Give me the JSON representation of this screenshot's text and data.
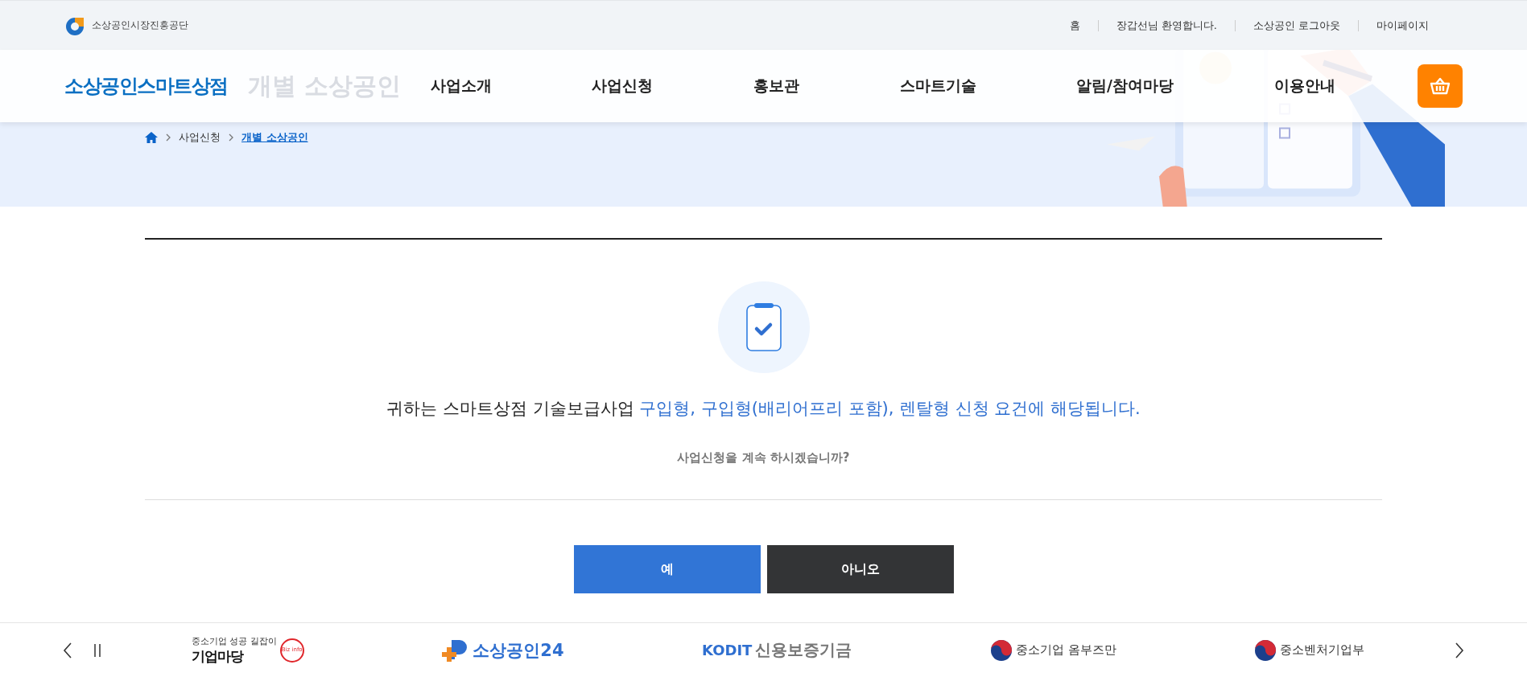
{
  "top_bar": {
    "agency": "소상공인시장진흥공단",
    "links": [
      "홈",
      "장갑선님 환영합니다.",
      "소상공인 로그아웃",
      "마이페이지"
    ]
  },
  "header": {
    "brand": "소상공인스마트상점",
    "menu": [
      {
        "label": "사업소개",
        "selected": false
      },
      {
        "label": "사업신청",
        "selected": false
      },
      {
        "label": "홍보관",
        "selected": false
      },
      {
        "label": "스마트기술",
        "selected": false
      },
      {
        "label": "알림/참여마당",
        "selected": false
      },
      {
        "label": "이용안내",
        "selected": false
      }
    ]
  },
  "hero": {
    "title": "개별 소상공인",
    "breadcrumb": [
      "사업신청",
      "개별 소상공인"
    ]
  },
  "result": {
    "lead": "귀하는 스마트상점 기술보급사업 ",
    "highlight": "구입형, 구입형(배리어프리 포함), 렌탈형 신청 요건에 해당됩니다.",
    "question": "사업신청을 계속 하시겠습니까?"
  },
  "buttons": [
    {
      "label": "예",
      "kind": "primary"
    },
    {
      "label": "아니오",
      "kind": "secondary"
    }
  ],
  "footer": {
    "partners": [
      {
        "kind": "bizinfo",
        "tagline": "중소기업 성공 길잡이",
        "name": "기업마당",
        "badge": "Biz info"
      },
      {
        "kind": "sbiz24",
        "name": "소상공인24"
      },
      {
        "kind": "kodit",
        "mark": "KODIT",
        "name": "신용보증기금"
      },
      {
        "kind": "gov",
        "name": "중소기업 옴부즈만"
      },
      {
        "kind": "gov",
        "name": "중소벤처기업부"
      }
    ]
  }
}
